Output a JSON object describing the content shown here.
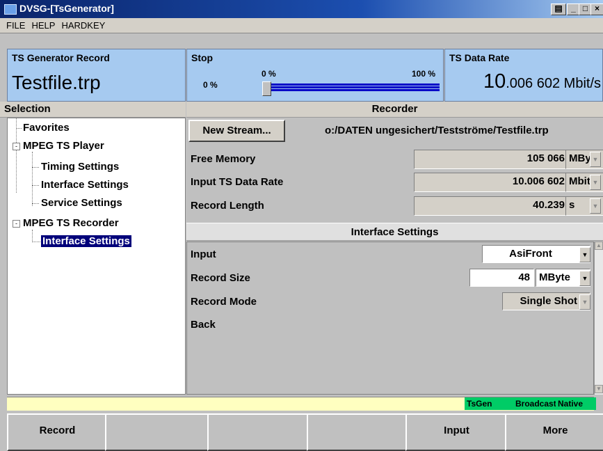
{
  "window": {
    "title": "DVSG-[TsGenerator]",
    "buttons": [
      "_",
      "□",
      "×"
    ]
  },
  "menu": [
    "FILE",
    "HELP",
    "HARDKEY"
  ],
  "header": {
    "record_label": "TS Generator Record",
    "record_file": "Testfile.trp",
    "stop_label": "Stop",
    "progress_left": "0 %",
    "progress_min": "0 %",
    "progress_max": "100 %",
    "progress_value": 0,
    "rate_label": "TS Data Rate",
    "rate_major": "10",
    "rate_minor": ".006 602 Mbit/s"
  },
  "selection": {
    "heading": "Selection",
    "items": [
      {
        "label": "Favorites"
      },
      {
        "label": "MPEG TS Player",
        "expander": "-"
      },
      {
        "label": "Timing Settings"
      },
      {
        "label": "Interface Settings"
      },
      {
        "label": "Service Settings"
      },
      {
        "label": "MPEG TS Recorder",
        "expander": "-"
      },
      {
        "label": "Interface Settings",
        "selected": true
      }
    ]
  },
  "recorder": {
    "heading": "Recorder",
    "new_stream_label": "New Stream...",
    "path": "o:/DATEN ungesichert/Testströme/Testfile.trp",
    "rows": [
      {
        "label": "Free Memory",
        "value": "105 066",
        "unit": "MByte"
      },
      {
        "label": "Input TS Data Rate",
        "value": "10.006 602",
        "unit": "Mbit/s"
      },
      {
        "label": "Record Length",
        "value": "40.239",
        "unit": "s"
      }
    ]
  },
  "interface": {
    "heading": "Interface Settings",
    "input_label": "Input",
    "input_value": "AsiFront",
    "record_size_label": "Record Size",
    "record_size_value": "48",
    "record_size_unit": "MByte",
    "record_mode_label": "Record Mode",
    "record_mode_value": "Single Shot",
    "back_label": "Back"
  },
  "status": {
    "items": [
      "TsGen",
      "Broadcast",
      "Native"
    ]
  },
  "softkeys": [
    "Record",
    "",
    "",
    "",
    "Input",
    "More"
  ]
}
